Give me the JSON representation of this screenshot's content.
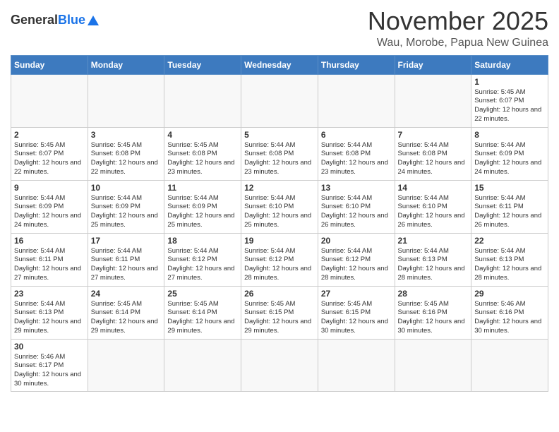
{
  "header": {
    "logo_general": "General",
    "logo_blue": "Blue",
    "month_title": "November 2025",
    "location": "Wau, Morobe, Papua New Guinea"
  },
  "days_of_week": [
    "Sunday",
    "Monday",
    "Tuesday",
    "Wednesday",
    "Thursday",
    "Friday",
    "Saturday"
  ],
  "weeks": [
    [
      {
        "day": "",
        "info": ""
      },
      {
        "day": "",
        "info": ""
      },
      {
        "day": "",
        "info": ""
      },
      {
        "day": "",
        "info": ""
      },
      {
        "day": "",
        "info": ""
      },
      {
        "day": "",
        "info": ""
      },
      {
        "day": "1",
        "info": "Sunrise: 5:45 AM\nSunset: 6:07 PM\nDaylight: 12 hours and 22 minutes."
      }
    ],
    [
      {
        "day": "2",
        "info": "Sunrise: 5:45 AM\nSunset: 6:07 PM\nDaylight: 12 hours and 22 minutes."
      },
      {
        "day": "3",
        "info": "Sunrise: 5:45 AM\nSunset: 6:08 PM\nDaylight: 12 hours and 22 minutes."
      },
      {
        "day": "4",
        "info": "Sunrise: 5:45 AM\nSunset: 6:08 PM\nDaylight: 12 hours and 23 minutes."
      },
      {
        "day": "5",
        "info": "Sunrise: 5:44 AM\nSunset: 6:08 PM\nDaylight: 12 hours and 23 minutes."
      },
      {
        "day": "6",
        "info": "Sunrise: 5:44 AM\nSunset: 6:08 PM\nDaylight: 12 hours and 23 minutes."
      },
      {
        "day": "7",
        "info": "Sunrise: 5:44 AM\nSunset: 6:08 PM\nDaylight: 12 hours and 24 minutes."
      },
      {
        "day": "8",
        "info": "Sunrise: 5:44 AM\nSunset: 6:09 PM\nDaylight: 12 hours and 24 minutes."
      }
    ],
    [
      {
        "day": "9",
        "info": "Sunrise: 5:44 AM\nSunset: 6:09 PM\nDaylight: 12 hours and 24 minutes."
      },
      {
        "day": "10",
        "info": "Sunrise: 5:44 AM\nSunset: 6:09 PM\nDaylight: 12 hours and 25 minutes."
      },
      {
        "day": "11",
        "info": "Sunrise: 5:44 AM\nSunset: 6:09 PM\nDaylight: 12 hours and 25 minutes."
      },
      {
        "day": "12",
        "info": "Sunrise: 5:44 AM\nSunset: 6:10 PM\nDaylight: 12 hours and 25 minutes."
      },
      {
        "day": "13",
        "info": "Sunrise: 5:44 AM\nSunset: 6:10 PM\nDaylight: 12 hours and 26 minutes."
      },
      {
        "day": "14",
        "info": "Sunrise: 5:44 AM\nSunset: 6:10 PM\nDaylight: 12 hours and 26 minutes."
      },
      {
        "day": "15",
        "info": "Sunrise: 5:44 AM\nSunset: 6:11 PM\nDaylight: 12 hours and 26 minutes."
      }
    ],
    [
      {
        "day": "16",
        "info": "Sunrise: 5:44 AM\nSunset: 6:11 PM\nDaylight: 12 hours and 27 minutes."
      },
      {
        "day": "17",
        "info": "Sunrise: 5:44 AM\nSunset: 6:11 PM\nDaylight: 12 hours and 27 minutes."
      },
      {
        "day": "18",
        "info": "Sunrise: 5:44 AM\nSunset: 6:12 PM\nDaylight: 12 hours and 27 minutes."
      },
      {
        "day": "19",
        "info": "Sunrise: 5:44 AM\nSunset: 6:12 PM\nDaylight: 12 hours and 28 minutes."
      },
      {
        "day": "20",
        "info": "Sunrise: 5:44 AM\nSunset: 6:12 PM\nDaylight: 12 hours and 28 minutes."
      },
      {
        "day": "21",
        "info": "Sunrise: 5:44 AM\nSunset: 6:13 PM\nDaylight: 12 hours and 28 minutes."
      },
      {
        "day": "22",
        "info": "Sunrise: 5:44 AM\nSunset: 6:13 PM\nDaylight: 12 hours and 28 minutes."
      }
    ],
    [
      {
        "day": "23",
        "info": "Sunrise: 5:44 AM\nSunset: 6:13 PM\nDaylight: 12 hours and 29 minutes."
      },
      {
        "day": "24",
        "info": "Sunrise: 5:45 AM\nSunset: 6:14 PM\nDaylight: 12 hours and 29 minutes."
      },
      {
        "day": "25",
        "info": "Sunrise: 5:45 AM\nSunset: 6:14 PM\nDaylight: 12 hours and 29 minutes."
      },
      {
        "day": "26",
        "info": "Sunrise: 5:45 AM\nSunset: 6:15 PM\nDaylight: 12 hours and 29 minutes."
      },
      {
        "day": "27",
        "info": "Sunrise: 5:45 AM\nSunset: 6:15 PM\nDaylight: 12 hours and 30 minutes."
      },
      {
        "day": "28",
        "info": "Sunrise: 5:45 AM\nSunset: 6:16 PM\nDaylight: 12 hours and 30 minutes."
      },
      {
        "day": "29",
        "info": "Sunrise: 5:46 AM\nSunset: 6:16 PM\nDaylight: 12 hours and 30 minutes."
      }
    ],
    [
      {
        "day": "30",
        "info": "Sunrise: 5:46 AM\nSunset: 6:17 PM\nDaylight: 12 hours and 30 minutes."
      },
      {
        "day": "",
        "info": ""
      },
      {
        "day": "",
        "info": ""
      },
      {
        "day": "",
        "info": ""
      },
      {
        "day": "",
        "info": ""
      },
      {
        "day": "",
        "info": ""
      },
      {
        "day": "",
        "info": ""
      }
    ]
  ]
}
